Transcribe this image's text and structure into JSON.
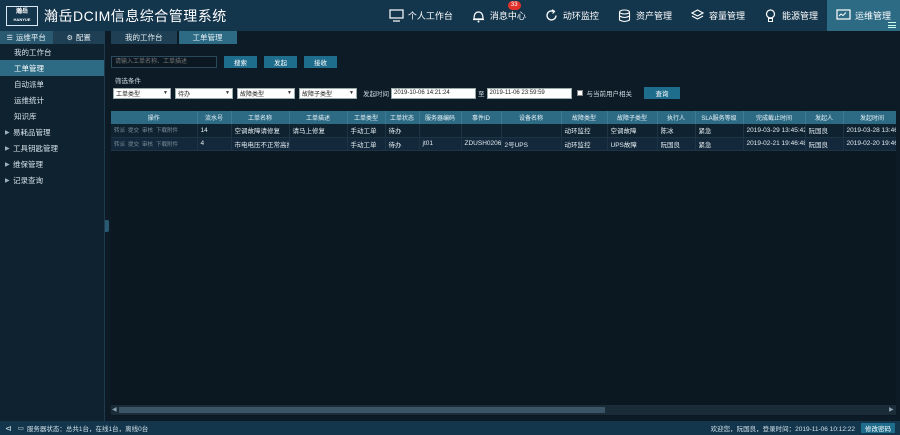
{
  "header": {
    "logo_line1": "瀚岳",
    "logo_line2": "HANYUE",
    "title": "瀚岳DCIM信息综合管理系统",
    "nav": [
      {
        "label": "个人工作台",
        "icon": "monitor-icon"
      },
      {
        "label": "消息中心",
        "icon": "bell-icon",
        "badge": "33"
      },
      {
        "label": "动环监控",
        "icon": "refresh-icon"
      },
      {
        "label": "资产管理",
        "icon": "database-icon"
      },
      {
        "label": "容量管理",
        "icon": "layers-icon"
      },
      {
        "label": "能源管理",
        "icon": "bulb-icon"
      },
      {
        "label": "运维管理",
        "icon": "screen-icon",
        "active": true
      }
    ]
  },
  "left_tabs": [
    {
      "label": "运维平台",
      "glyph": "☰"
    },
    {
      "label": "配置",
      "glyph": "⚙"
    }
  ],
  "sidebar": {
    "items": [
      {
        "label": "我的工作台"
      },
      {
        "label": "工单管理",
        "active": true
      },
      {
        "label": "自动派单"
      },
      {
        "label": "运维统计"
      },
      {
        "label": "知识库"
      },
      {
        "label": "易耗品管理",
        "group": true
      },
      {
        "label": "工具钥匙管理",
        "group": true
      },
      {
        "label": "维保管理",
        "group": true
      },
      {
        "label": "记录查询",
        "group": true
      }
    ]
  },
  "main_tabs": [
    {
      "label": "我的工作台"
    },
    {
      "label": "工单管理",
      "active": true
    }
  ],
  "search": {
    "placeholder": "请输入工单名称、工单描述",
    "btn_search": "搜索",
    "btn_launch": "发起",
    "btn_accept": "接收"
  },
  "filter": {
    "label": "筛选条件",
    "selects": [
      "工单类型",
      "待办",
      "故障类型",
      "故障子类型"
    ],
    "time_label": "发起时间",
    "date_from": "2019-10-06 14:21:24",
    "to_label": "至",
    "date_to": "2019-11-06 23:59:59",
    "related_label": "与当前用户相关",
    "btn_query": "查询"
  },
  "table": {
    "columns": [
      "操作",
      "流水号",
      "工单名称",
      "工单描述",
      "工单类型",
      "工单状态",
      "服务器编码",
      "事件ID",
      "设备名称",
      "故障类型",
      "故障子类型",
      "执行人",
      "SLA服务等级",
      "完成截止时间",
      "发起人",
      "发起时间"
    ],
    "ops": [
      "转派",
      "提交",
      "审核",
      "下载附件"
    ],
    "rows": [
      [
        "",
        "14",
        "空调故障请修复",
        "请马上修复",
        "手动工单",
        "待办",
        "",
        "",
        "",
        "动环监控",
        "空调故障",
        "陈冰",
        "紧急",
        "2019-03-29 13:45:42",
        "阮国良",
        "2019-03-28 13:46"
      ],
      [
        "",
        "4",
        "市电电压不正常高报",
        "",
        "手动工单",
        "待办",
        "jt01",
        "ZDUSH0206",
        "2号UPS",
        "动环监控",
        "UPS故障",
        "阮国良",
        "紧急",
        "2019-02-21 19:46:48",
        "阮国良",
        "2019-02-20 19:46"
      ]
    ]
  },
  "status": {
    "server_status": "服务器状态：总共1台，在线1台，离线0台",
    "welcome": "欢迎您，阮国良，登录时间：2019-11-06 10:12:22",
    "btn_pwd": "修改密码"
  }
}
